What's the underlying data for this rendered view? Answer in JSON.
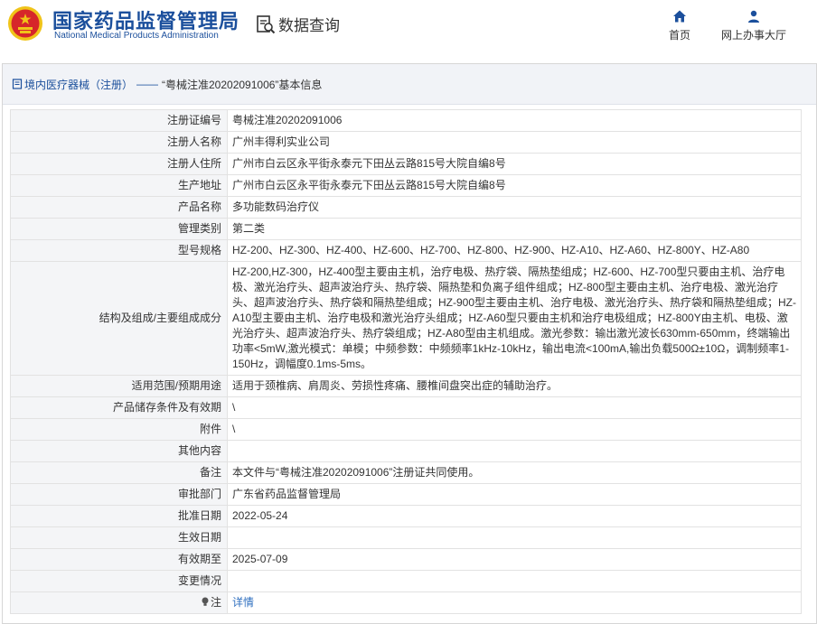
{
  "header": {
    "brand_cn": "国家药品监督管理局",
    "brand_en": "National Medical Products Administration",
    "module_title": "数据查询",
    "nav": [
      {
        "label": "首页",
        "icon": "home-icon"
      },
      {
        "label": "网上办事大厅",
        "icon": "user-icon"
      }
    ]
  },
  "breadcrumb": {
    "category": "境内医疗器械（注册）",
    "separator": "——",
    "title": "“粤械注准20202091006”基本信息"
  },
  "fields": [
    {
      "label": "注册证编号",
      "value": "粤械注准20202091006"
    },
    {
      "label": "注册人名称",
      "value": "广州丰得利实业公司"
    },
    {
      "label": "注册人住所",
      "value": "广州市白云区永平街永泰元下田丛云路815号大院自编8号"
    },
    {
      "label": "生产地址",
      "value": "广州市白云区永平街永泰元下田丛云路815号大院自编8号"
    },
    {
      "label": "产品名称",
      "value": "多功能数码治疗仪"
    },
    {
      "label": "管理类别",
      "value": "第二类"
    },
    {
      "label": "型号规格",
      "value": "HZ-200、HZ-300、HZ-400、HZ-600、HZ-700、HZ-800、HZ-900、HZ-A10、HZ-A60、HZ-800Y、HZ-A80"
    },
    {
      "label": "结构及组成/主要组成成分",
      "value": "HZ-200,HZ-300，HZ-400型主要由主机，治疗电极、热疗袋、隔热垫组成；HZ-600、HZ-700型只要由主机、治疗电极、激光治疗头、超声波治疗头、热疗袋、隔热垫和负离子组件组成；HZ-800型主要由主机、治疗电极、激光治疗头、超声波治疗头、热疗袋和隔热垫组成；HZ-900型主要由主机、治疗电极、激光治疗头、热疗袋和隔热垫组成；HZ-A10型主要由主机、治疗电极和激光治疗头组成；HZ-A60型只要由主机和治疗电极组成；HZ-800Y由主机、电极、激光治疗头、超声波治疗头、热疗袋组成；HZ-A80型由主机组成。激光参数：输出激光波长630mm-650mm，终端输出功率<5mW,激光模式：单模；中频参数：中频频率1kHz-10kHz，输出电流<100mA,输出负载500Ω±10Ω，调制频率1-150Hz，调幅度0.1ms-5ms。",
      "tall": true
    },
    {
      "label": "适用范围/预期用途",
      "value": "适用于颈椎病、肩周炎、劳损性疼痛、腰椎间盘突出症的辅助治疗。"
    },
    {
      "label": "产品储存条件及有效期",
      "value": "\\"
    },
    {
      "label": "附件",
      "value": "\\"
    },
    {
      "label": "其他内容",
      "value": ""
    },
    {
      "label": "备注",
      "value": "本文件与“粤械注准20202091006”注册证共同使用。"
    },
    {
      "label": "审批部门",
      "value": "广东省药品监督管理局"
    },
    {
      "label": "批准日期",
      "value": "2022-05-24"
    },
    {
      "label": "生效日期",
      "value": ""
    },
    {
      "label": "有效期至",
      "value": "2025-07-09"
    },
    {
      "label": "变更情况",
      "value": ""
    }
  ],
  "note": {
    "label": "注",
    "icon": "lightbulb-icon",
    "link": "详情"
  },
  "colors": {
    "brand": "#1b4f9c",
    "link": "#2f6fbf",
    "label_bg": "#f4f5f7",
    "emblem_red": "#d6262a",
    "emblem_gold": "#f0c419"
  }
}
